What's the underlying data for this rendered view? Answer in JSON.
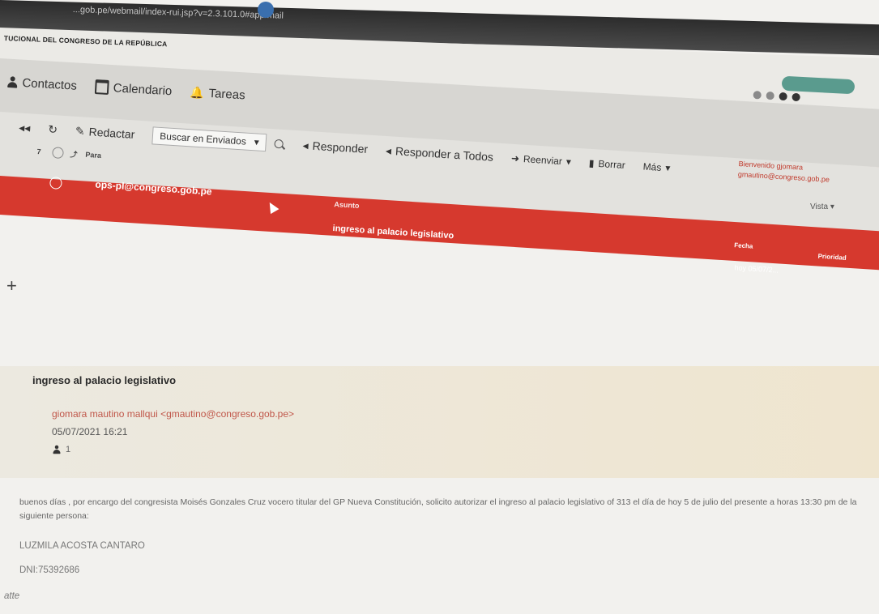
{
  "browser": {
    "url": "...gob.pe/webmail/index-rui.jsp?v=2.3.101.0#app/mail"
  },
  "header": {
    "institution": "TUCIONAL DEL CONGRESO DE LA REPÚBLICA"
  },
  "nav": {
    "items": [
      {
        "label": "Contactos",
        "icon": "person-icon"
      },
      {
        "label": "Calendario",
        "icon": "calendar-icon"
      },
      {
        "label": "Tareas",
        "icon": "bell-icon"
      }
    ]
  },
  "toolbar": {
    "back": "◂◂",
    "refresh": "↻",
    "compose": "Redactar",
    "search_folder": "Buscar en Enviados",
    "reply": "Responder",
    "reply_all": "Responder a Todos",
    "forward": "Reenviar",
    "delete": "Borrar",
    "more": "Más"
  },
  "welcome": {
    "greeting": "Bienvenido gjomara",
    "email": "gmautino@congreso.gob.pe"
  },
  "list": {
    "count": "7",
    "col_to": "Para",
    "col_subject": "Asunto",
    "col_date": "Fecha",
    "col_priority": "Prioridad",
    "view_label": "Vista",
    "selected_row": {
      "to": "ops-pl@congreso.gob.pe",
      "subject": "ingreso al palacio legislativo",
      "date": "hoy 05/07/2..."
    }
  },
  "message": {
    "subject": "ingreso al palacio legislativo",
    "from": "giomara mautino mallqui <gmautino@congreso.gob.pe>",
    "date": "05/07/2021 16:21",
    "recipients_count": "1",
    "body": "buenos días , por encargo del congresista Moisés Gonzales Cruz vocero titular del GP Nueva Constitución, solicito autorizar el ingreso al palacio legislativo of 313 el día de hoy 5 de julio del presente a horas 13:30 pm de la siguiente persona:",
    "person": "LUZMILA ACOSTA CANTARO",
    "dni": "DNI:75392686",
    "closing": "atte"
  },
  "colors": {
    "accent_red": "#d6392e",
    "sender_link": "#c0574a"
  }
}
